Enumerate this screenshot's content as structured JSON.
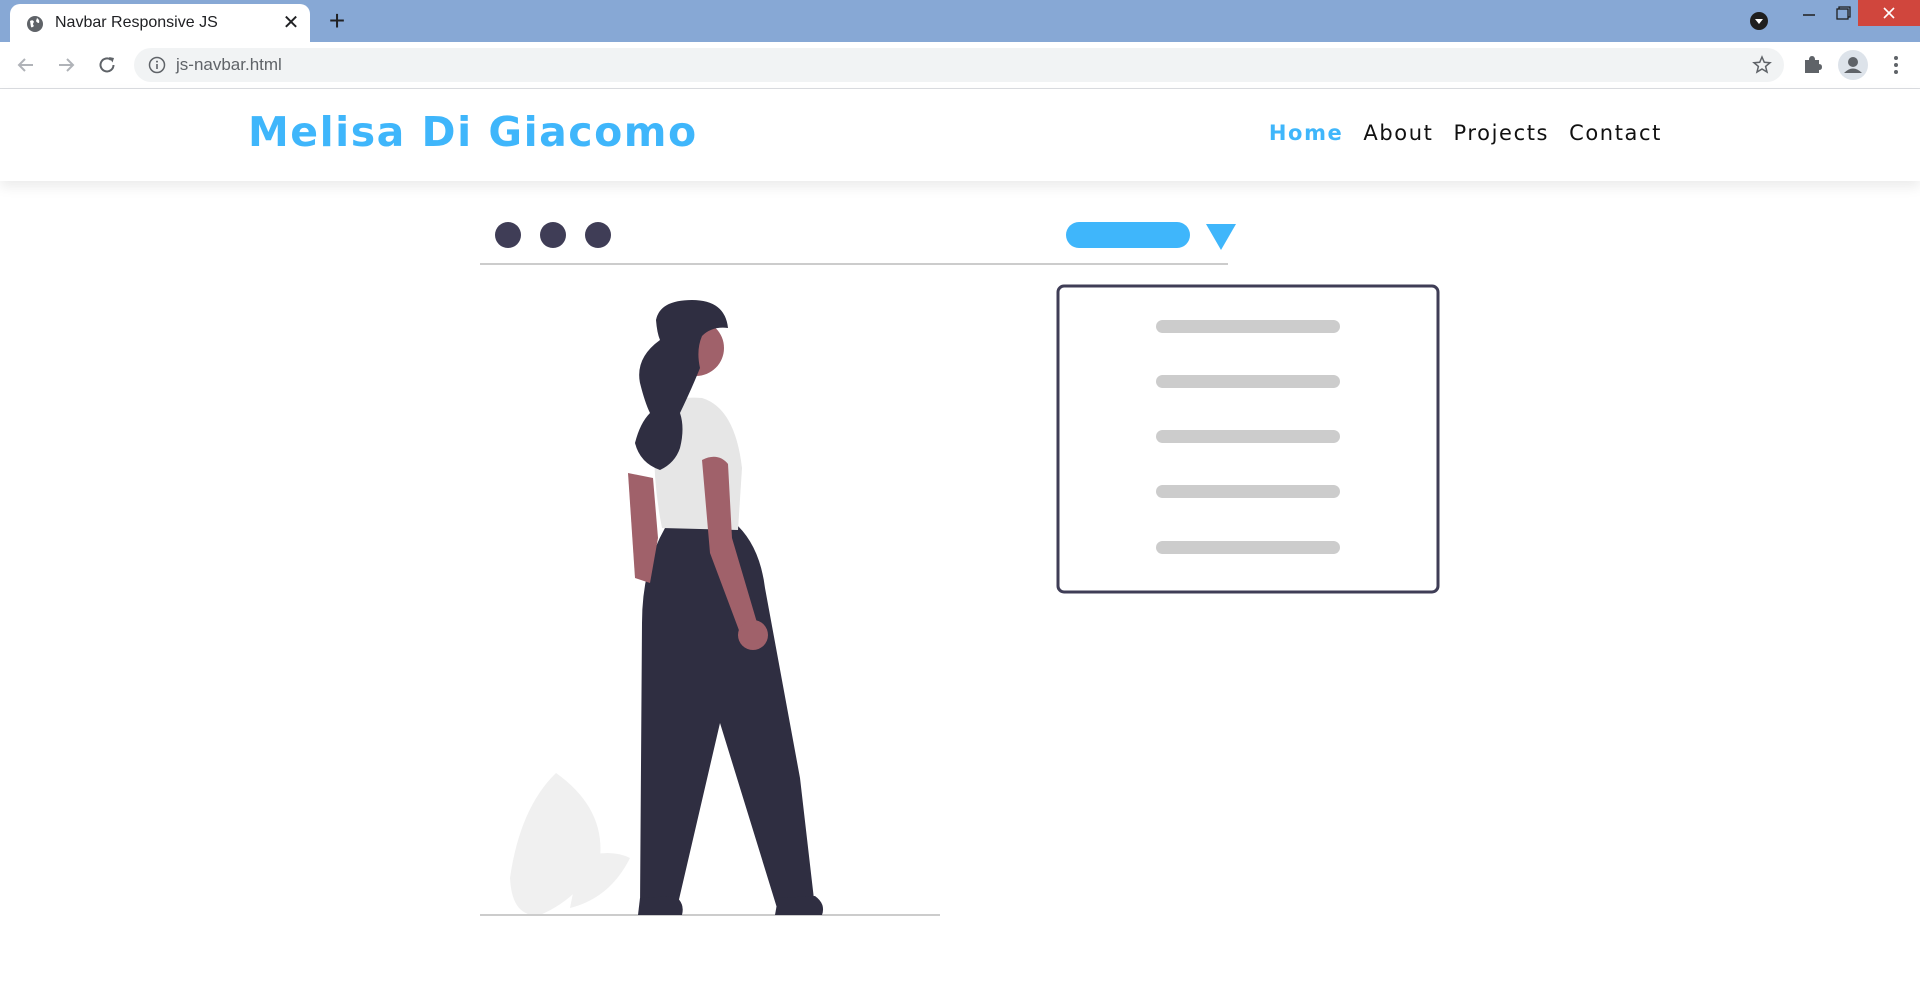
{
  "browser": {
    "tab_title": "Navbar Responsive JS",
    "url": "js-navbar.html"
  },
  "site": {
    "logo_text": "Melisa Di Giacomo",
    "nav": [
      {
        "label": "Home",
        "active": true
      },
      {
        "label": "About",
        "active": false
      },
      {
        "label": "Projects",
        "active": false
      },
      {
        "label": "Contact",
        "active": false
      }
    ]
  },
  "colors": {
    "accent": "#3fb6fb",
    "chrome": "#87a8d5",
    "close": "#d0463d",
    "dark": "#2f2e41",
    "skin": "#a0616a",
    "shirt": "#e6e6e6",
    "line": "#cccccc"
  },
  "icons": {
    "favicon": "globe-icon",
    "back": "arrow-left-icon",
    "forward": "arrow-right-icon",
    "reload": "reload-icon",
    "info": "info-icon",
    "bookmark": "star-icon",
    "extensions": "puzzle-icon",
    "profile": "account-icon",
    "menu": "kebab-menu-icon"
  }
}
